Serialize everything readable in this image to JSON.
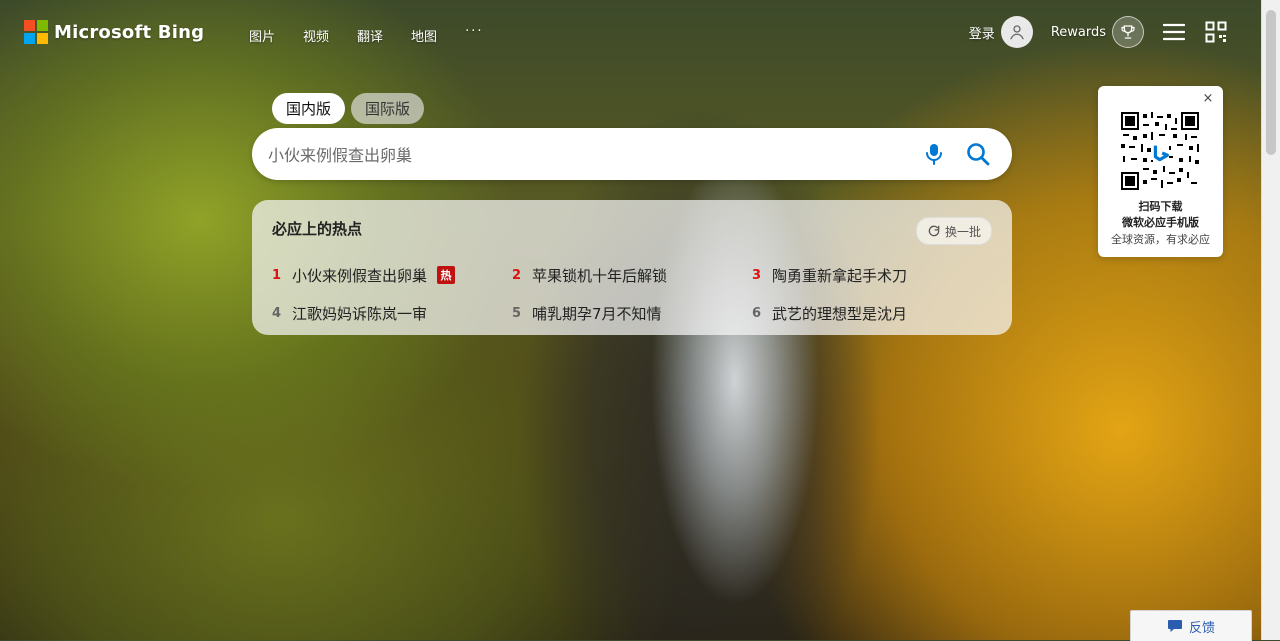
{
  "brand": {
    "name": "Microsoft Bing",
    "logo_colors": [
      "#f25022",
      "#7fba00",
      "#00a4ef",
      "#ffb900"
    ]
  },
  "nav": {
    "items": [
      {
        "label": "图片"
      },
      {
        "label": "视频"
      },
      {
        "label": "翻译"
      },
      {
        "label": "地图"
      }
    ],
    "more_label": "···"
  },
  "header": {
    "sign_in_label": "登录",
    "rewards_label": "Rewards"
  },
  "market_tabs": {
    "items": [
      {
        "label": "国内版",
        "active": true
      },
      {
        "label": "国际版",
        "active": false
      }
    ]
  },
  "search": {
    "placeholder": "小伙来例假查出卵巢",
    "value": ""
  },
  "trending": {
    "title": "必应上的热点",
    "refresh_label": "换一批",
    "items": [
      {
        "rank": "1",
        "text": "小伙来例假查出卵巢",
        "badge": "热"
      },
      {
        "rank": "2",
        "text": "苹果锁机十年后解锁",
        "badge": ""
      },
      {
        "rank": "3",
        "text": "陶勇重新拿起手术刀",
        "badge": ""
      },
      {
        "rank": "4",
        "text": "江歌妈妈诉陈岚一审",
        "badge": ""
      },
      {
        "rank": "5",
        "text": "哺乳期孕7月不知情",
        "badge": ""
      },
      {
        "rank": "6",
        "text": "武艺的理想型是沈月",
        "badge": ""
      }
    ]
  },
  "qr_card": {
    "title": "扫码下载",
    "subtitle": "微软必应手机版",
    "caption": "全球资源，有求必应"
  },
  "feedback": {
    "label": "反馈"
  },
  "colors": {
    "hot_rank": "#dd1111",
    "accent_blue": "#0078d4",
    "badge_red": "#c01111"
  }
}
